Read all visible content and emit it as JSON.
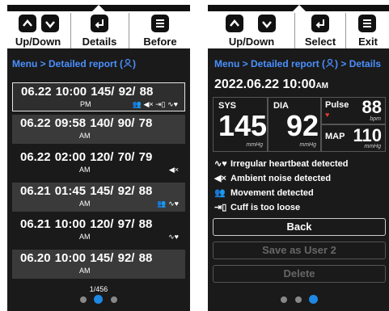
{
  "left": {
    "toolbar": {
      "updown_label": "Up/Down",
      "details_label": "Details",
      "before_label": "Before"
    },
    "breadcrumb": "Menu > Detailed report (",
    "breadcrumb_end": ")",
    "rows": [
      {
        "text": "06.22  10:00   145/  92/  88",
        "ampm": "PM",
        "icons": "👥 ◀× ⇥▯ ∿♥"
      },
      {
        "text": "06.22  09:58   140/  90/  78",
        "ampm": "AM",
        "icons": ""
      },
      {
        "text": "06.22  02:00   120/  70/  79",
        "ampm": "AM",
        "icons": "◀×"
      },
      {
        "text": "06.21  01:45   145/  92/  88",
        "ampm": "AM",
        "icons": "👥   ∿♥"
      },
      {
        "text": "06.21  10:00   120/  97/  88",
        "ampm": "AM",
        "icons": "∿♥"
      },
      {
        "text": "06.20  10:00   145/  92/  88",
        "ampm": "AM",
        "icons": ""
      }
    ],
    "pager": "1/456"
  },
  "right": {
    "toolbar": {
      "updown_label": "Up/Down",
      "select_label": "Select",
      "exit_label": "Exit"
    },
    "breadcrumb": "Menu > Detailed report (",
    "breadcrumb_end": ") > Details",
    "date": "2022.06.22 10:00",
    "date_ampm": "AM",
    "sys_label": "SYS",
    "sys_value": "145",
    "sys_unit": "mmHg",
    "dia_label": "DIA",
    "dia_value": "92",
    "dia_unit": "mmHg",
    "pulse_label": "Pulse",
    "pulse_value": "88",
    "pulse_unit": "bpm",
    "map_label": "MAP",
    "map_value": "110",
    "map_unit": "mmHg",
    "events": [
      {
        "icon": "∿♥",
        "label": "Irregular heartbeat detected"
      },
      {
        "icon": "◀×",
        "label": "Ambient noise detected"
      },
      {
        "icon": "👥",
        "label": "Movement detected"
      },
      {
        "icon": "⇥▯",
        "label": "Cuff is too loose"
      }
    ],
    "back_label": "Back",
    "save_label": "Save as User 2",
    "delete_label": "Delete"
  },
  "colors": {
    "accent": "#4a90ff",
    "active_dot": "#1e88e5",
    "pulse_heart": "#e53935"
  }
}
